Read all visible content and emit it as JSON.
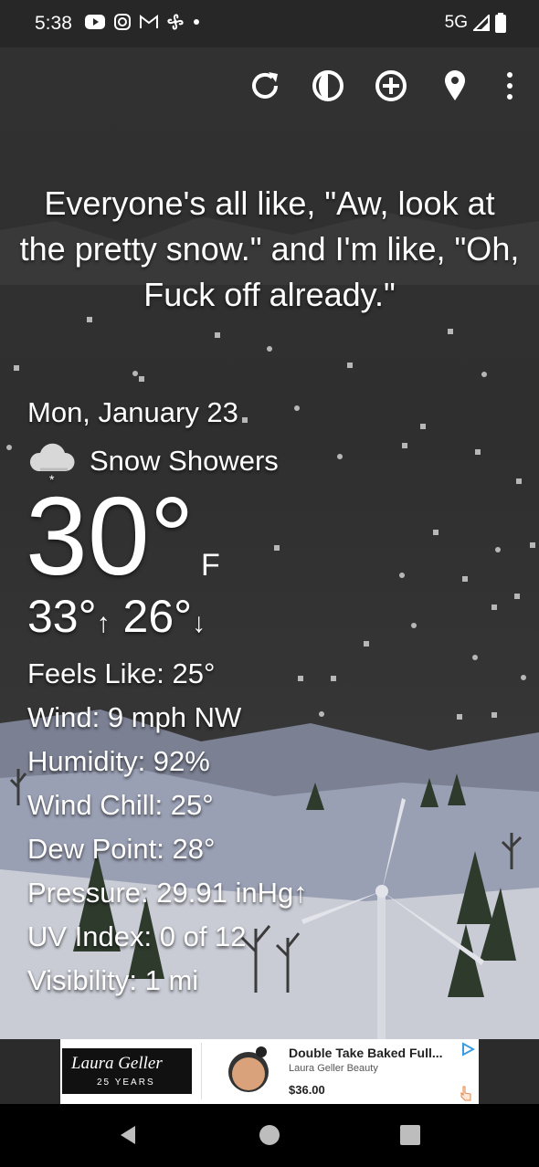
{
  "status": {
    "time": "5:38",
    "network": "5G"
  },
  "toolbar": {
    "icons": [
      "refresh-icon",
      "moon-phase-icon",
      "add-location-icon",
      "location-pin-icon",
      "more-vert-icon"
    ]
  },
  "quote": "Everyone's all like, \"Aw, look at the pretty snow.\" and I'm like, \"Oh, Fuck off already.\"",
  "weather": {
    "date": "Mon, January 23",
    "condition": "Snow Showers",
    "temp": "30°",
    "unit": "F",
    "high": "33°",
    "low": "26°",
    "details": [
      "Feels Like:  25°",
      "Wind:  9 mph NW",
      "Humidity:  92%",
      "Wind Chill:  25°",
      "Dew Point:  28°",
      "Pressure:  29.91 inHg↑",
      "UV Index:  0 of 12",
      "Visibility:  1 mi"
    ]
  },
  "ad": {
    "logo_text": "Laura Geller",
    "logo_sub": "25 YEARS",
    "title": "Double Take Baked Full...",
    "brand": "Laura Geller Beauty",
    "price": "$36.00"
  },
  "colors": {
    "sky": "#2f2f2f",
    "ground": "#bfc3cc",
    "tree": "#2e3a2c"
  }
}
